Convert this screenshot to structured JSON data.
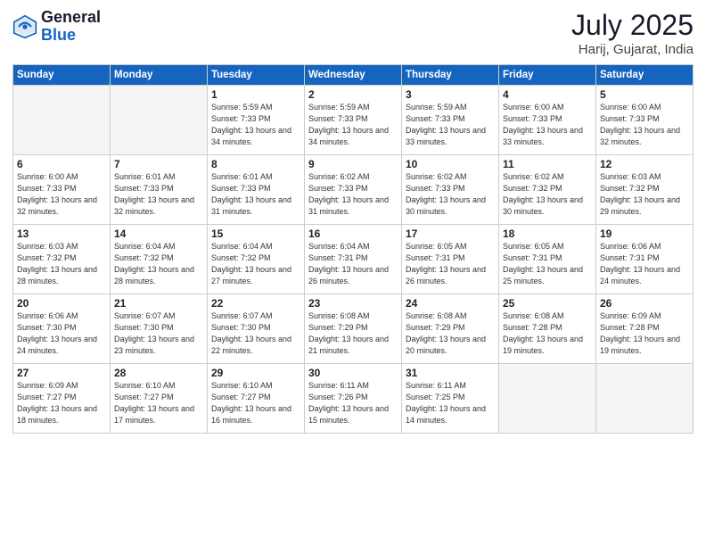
{
  "header": {
    "logo_line1": "General",
    "logo_line2": "Blue",
    "month": "July 2025",
    "location": "Harij, Gujarat, India"
  },
  "weekdays": [
    "Sunday",
    "Monday",
    "Tuesday",
    "Wednesday",
    "Thursday",
    "Friday",
    "Saturday"
  ],
  "weeks": [
    [
      {
        "num": "",
        "empty": true
      },
      {
        "num": "",
        "empty": true
      },
      {
        "num": "1",
        "sunrise": "Sunrise: 5:59 AM",
        "sunset": "Sunset: 7:33 PM",
        "daylight": "Daylight: 13 hours and 34 minutes."
      },
      {
        "num": "2",
        "sunrise": "Sunrise: 5:59 AM",
        "sunset": "Sunset: 7:33 PM",
        "daylight": "Daylight: 13 hours and 34 minutes."
      },
      {
        "num": "3",
        "sunrise": "Sunrise: 5:59 AM",
        "sunset": "Sunset: 7:33 PM",
        "daylight": "Daylight: 13 hours and 33 minutes."
      },
      {
        "num": "4",
        "sunrise": "Sunrise: 6:00 AM",
        "sunset": "Sunset: 7:33 PM",
        "daylight": "Daylight: 13 hours and 33 minutes."
      },
      {
        "num": "5",
        "sunrise": "Sunrise: 6:00 AM",
        "sunset": "Sunset: 7:33 PM",
        "daylight": "Daylight: 13 hours and 32 minutes."
      }
    ],
    [
      {
        "num": "6",
        "sunrise": "Sunrise: 6:00 AM",
        "sunset": "Sunset: 7:33 PM",
        "daylight": "Daylight: 13 hours and 32 minutes."
      },
      {
        "num": "7",
        "sunrise": "Sunrise: 6:01 AM",
        "sunset": "Sunset: 7:33 PM",
        "daylight": "Daylight: 13 hours and 32 minutes."
      },
      {
        "num": "8",
        "sunrise": "Sunrise: 6:01 AM",
        "sunset": "Sunset: 7:33 PM",
        "daylight": "Daylight: 13 hours and 31 minutes."
      },
      {
        "num": "9",
        "sunrise": "Sunrise: 6:02 AM",
        "sunset": "Sunset: 7:33 PM",
        "daylight": "Daylight: 13 hours and 31 minutes."
      },
      {
        "num": "10",
        "sunrise": "Sunrise: 6:02 AM",
        "sunset": "Sunset: 7:33 PM",
        "daylight": "Daylight: 13 hours and 30 minutes."
      },
      {
        "num": "11",
        "sunrise": "Sunrise: 6:02 AM",
        "sunset": "Sunset: 7:32 PM",
        "daylight": "Daylight: 13 hours and 30 minutes."
      },
      {
        "num": "12",
        "sunrise": "Sunrise: 6:03 AM",
        "sunset": "Sunset: 7:32 PM",
        "daylight": "Daylight: 13 hours and 29 minutes."
      }
    ],
    [
      {
        "num": "13",
        "sunrise": "Sunrise: 6:03 AM",
        "sunset": "Sunset: 7:32 PM",
        "daylight": "Daylight: 13 hours and 28 minutes."
      },
      {
        "num": "14",
        "sunrise": "Sunrise: 6:04 AM",
        "sunset": "Sunset: 7:32 PM",
        "daylight": "Daylight: 13 hours and 28 minutes."
      },
      {
        "num": "15",
        "sunrise": "Sunrise: 6:04 AM",
        "sunset": "Sunset: 7:32 PM",
        "daylight": "Daylight: 13 hours and 27 minutes."
      },
      {
        "num": "16",
        "sunrise": "Sunrise: 6:04 AM",
        "sunset": "Sunset: 7:31 PM",
        "daylight": "Daylight: 13 hours and 26 minutes."
      },
      {
        "num": "17",
        "sunrise": "Sunrise: 6:05 AM",
        "sunset": "Sunset: 7:31 PM",
        "daylight": "Daylight: 13 hours and 26 minutes."
      },
      {
        "num": "18",
        "sunrise": "Sunrise: 6:05 AM",
        "sunset": "Sunset: 7:31 PM",
        "daylight": "Daylight: 13 hours and 25 minutes."
      },
      {
        "num": "19",
        "sunrise": "Sunrise: 6:06 AM",
        "sunset": "Sunset: 7:31 PM",
        "daylight": "Daylight: 13 hours and 24 minutes."
      }
    ],
    [
      {
        "num": "20",
        "sunrise": "Sunrise: 6:06 AM",
        "sunset": "Sunset: 7:30 PM",
        "daylight": "Daylight: 13 hours and 24 minutes."
      },
      {
        "num": "21",
        "sunrise": "Sunrise: 6:07 AM",
        "sunset": "Sunset: 7:30 PM",
        "daylight": "Daylight: 13 hours and 23 minutes."
      },
      {
        "num": "22",
        "sunrise": "Sunrise: 6:07 AM",
        "sunset": "Sunset: 7:30 PM",
        "daylight": "Daylight: 13 hours and 22 minutes."
      },
      {
        "num": "23",
        "sunrise": "Sunrise: 6:08 AM",
        "sunset": "Sunset: 7:29 PM",
        "daylight": "Daylight: 13 hours and 21 minutes."
      },
      {
        "num": "24",
        "sunrise": "Sunrise: 6:08 AM",
        "sunset": "Sunset: 7:29 PM",
        "daylight": "Daylight: 13 hours and 20 minutes."
      },
      {
        "num": "25",
        "sunrise": "Sunrise: 6:08 AM",
        "sunset": "Sunset: 7:28 PM",
        "daylight": "Daylight: 13 hours and 19 minutes."
      },
      {
        "num": "26",
        "sunrise": "Sunrise: 6:09 AM",
        "sunset": "Sunset: 7:28 PM",
        "daylight": "Daylight: 13 hours and 19 minutes."
      }
    ],
    [
      {
        "num": "27",
        "sunrise": "Sunrise: 6:09 AM",
        "sunset": "Sunset: 7:27 PM",
        "daylight": "Daylight: 13 hours and 18 minutes."
      },
      {
        "num": "28",
        "sunrise": "Sunrise: 6:10 AM",
        "sunset": "Sunset: 7:27 PM",
        "daylight": "Daylight: 13 hours and 17 minutes."
      },
      {
        "num": "29",
        "sunrise": "Sunrise: 6:10 AM",
        "sunset": "Sunset: 7:27 PM",
        "daylight": "Daylight: 13 hours and 16 minutes."
      },
      {
        "num": "30",
        "sunrise": "Sunrise: 6:11 AM",
        "sunset": "Sunset: 7:26 PM",
        "daylight": "Daylight: 13 hours and 15 minutes."
      },
      {
        "num": "31",
        "sunrise": "Sunrise: 6:11 AM",
        "sunset": "Sunset: 7:25 PM",
        "daylight": "Daylight: 13 hours and 14 minutes."
      },
      {
        "num": "",
        "empty": true
      },
      {
        "num": "",
        "empty": true
      }
    ]
  ]
}
